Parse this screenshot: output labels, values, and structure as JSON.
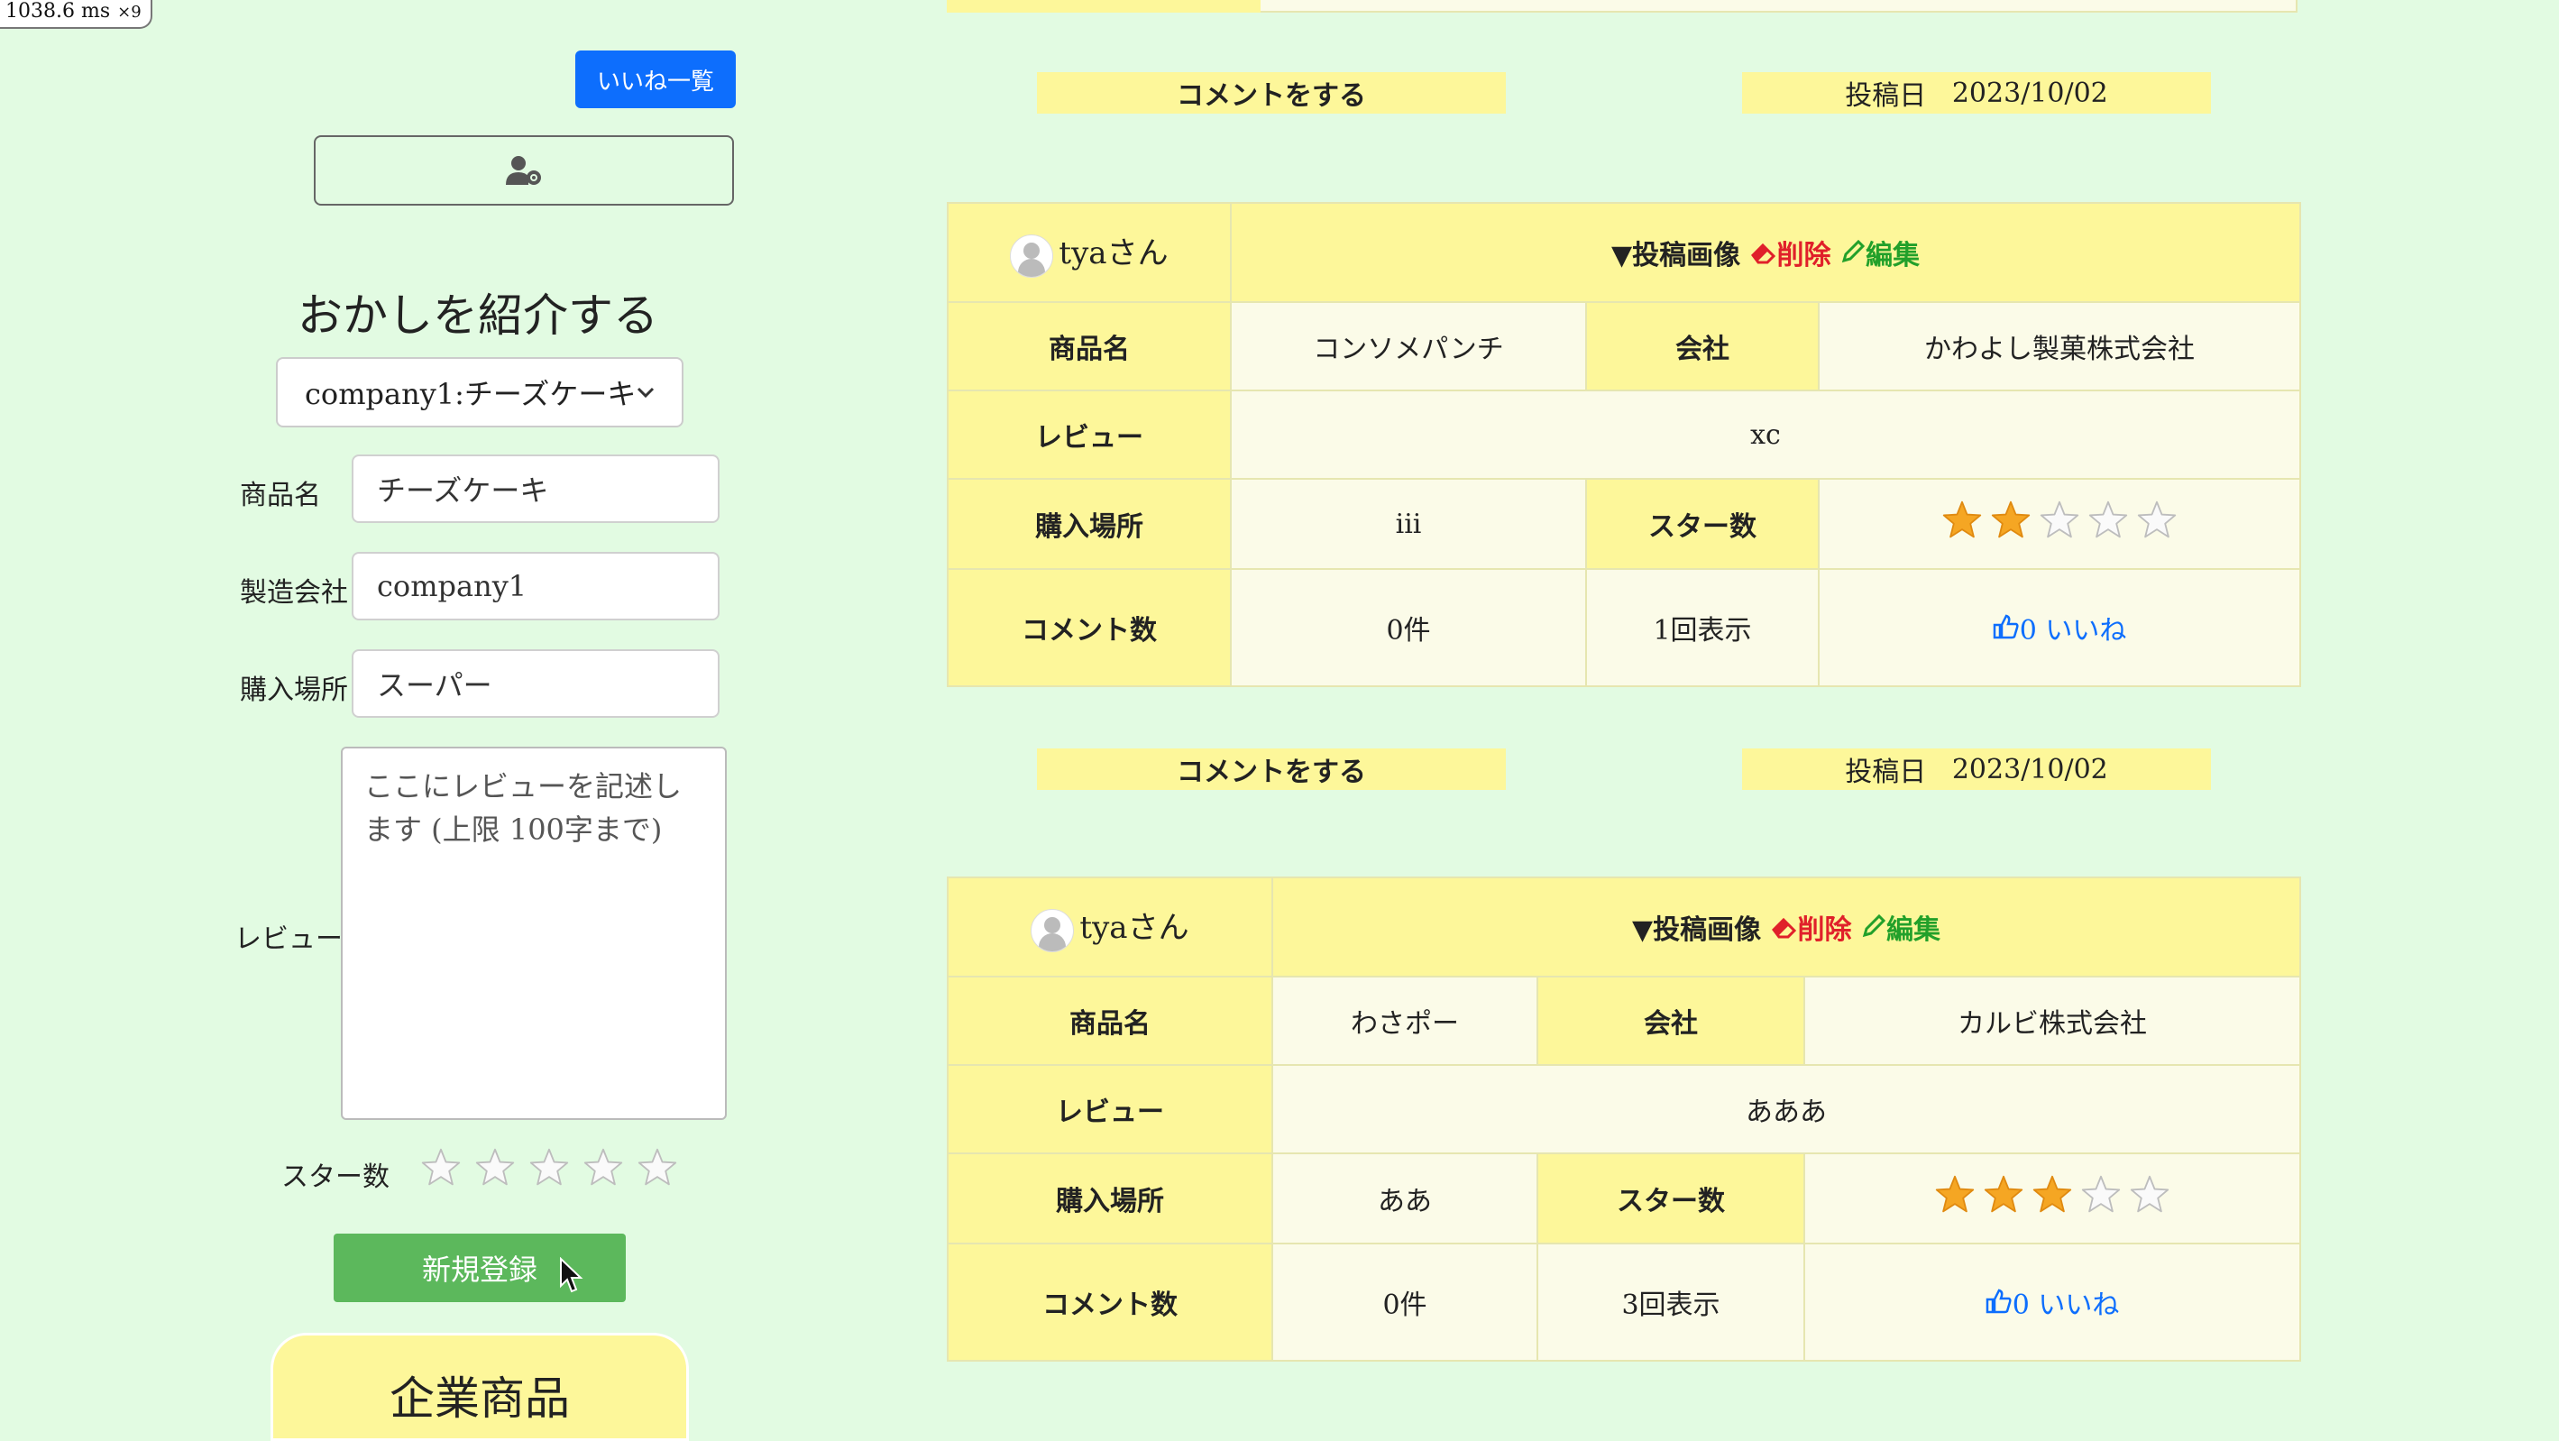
{
  "perf": {
    "time": "1038.6 ms",
    "mult": "×9"
  },
  "header": {
    "likes_list_label": "いいね一覧",
    "user_settings_icon": "user-gear-icon"
  },
  "form": {
    "title": "おかしを紹介する",
    "product_select": "company1:チーズケーキ",
    "product_name_label": "商品名",
    "product_name_value": "チーズケーキ",
    "maker_label": "製造会社",
    "maker_value": "company1",
    "place_label": "購入場所",
    "place_value": "スーパー",
    "review_label": "レビュー",
    "review_placeholder": "ここにレビューを記述します (上限 100字まで)",
    "stars_label": "スター数",
    "stars_value": 0,
    "submit_label": "新規登録",
    "company_tab_label": "企業商品"
  },
  "labels": {
    "comment_cta": "コメントをする",
    "posted_prefix": "投稿日",
    "image_toggle": "▼投稿画像",
    "delete": "削除",
    "edit": "編集",
    "product": "商品名",
    "company": "会社",
    "review": "レビュー",
    "place": "購入場所",
    "stars": "スター数",
    "comments": "コメント数",
    "likes_suffix": "いいね"
  },
  "posts": [
    {
      "comment_cta": "コメントをする",
      "posted_date": "2023/10/02",
      "user": "tyaさん",
      "product": "コンソメパンチ",
      "company": "かわよし製菓株式会社",
      "review": "xc",
      "place": "iii",
      "stars": 2,
      "comments": "0件",
      "views": "1回表示",
      "likes": "0"
    },
    {
      "comment_cta": "コメントをする",
      "posted_date": "2023/10/02",
      "user": "tyaさん",
      "product": "わさポー",
      "company": "カルビ株式会社",
      "review": "あああ",
      "place": "ああ",
      "stars": 3,
      "comments": "0件",
      "views": "3回表示",
      "likes": "0"
    }
  ],
  "colors": {
    "background": "#e2fbe2",
    "accent_yellow": "#fdf79a",
    "primary": "#0d6efd",
    "success": "#5cb85c",
    "danger": "#e0202a",
    "star_on": "#f5a623"
  }
}
